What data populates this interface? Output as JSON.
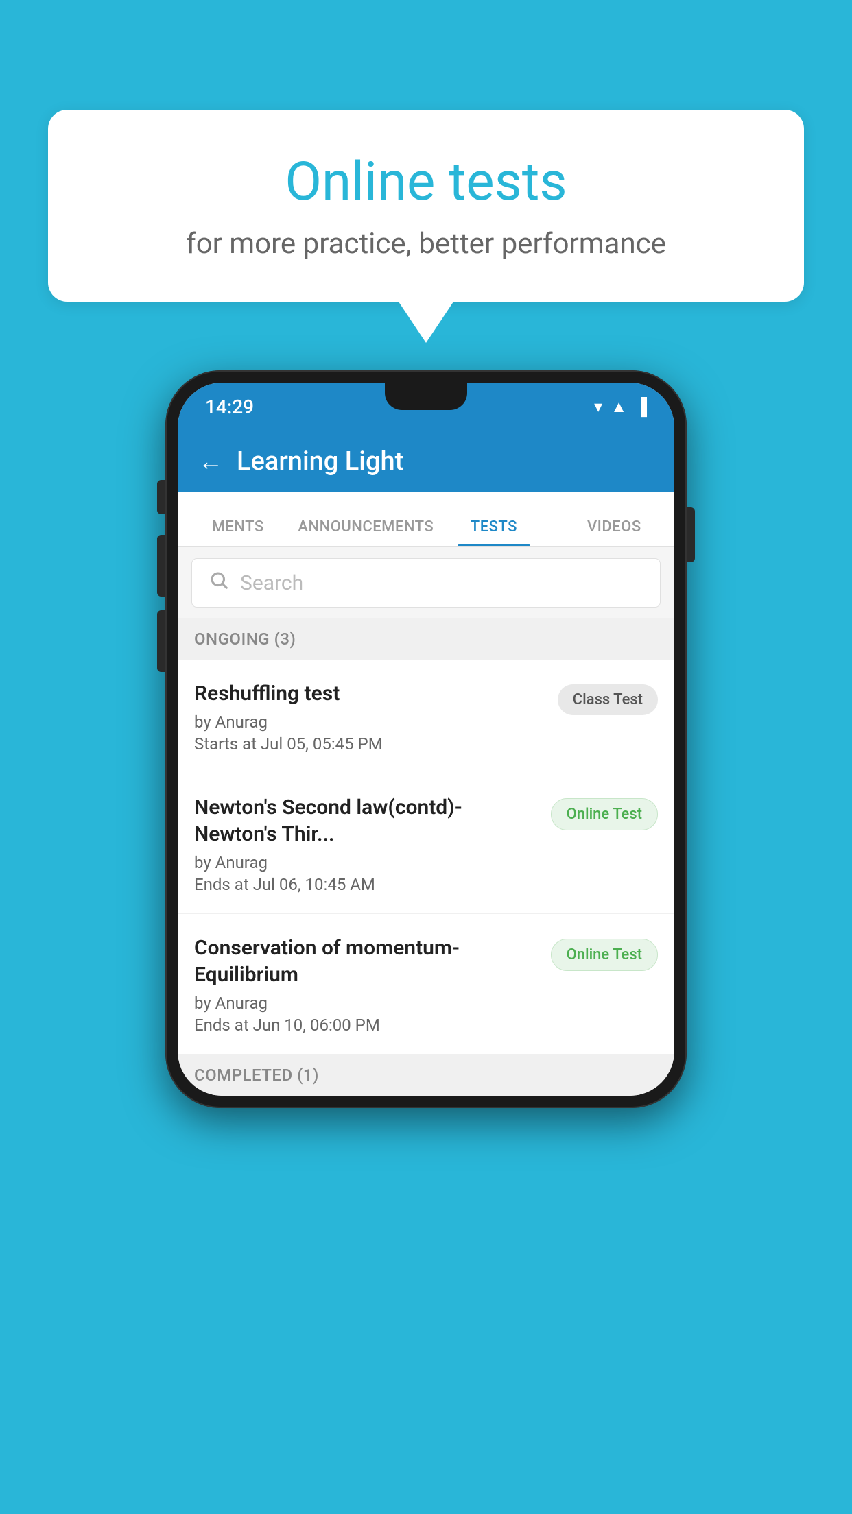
{
  "background": {
    "color": "#29b6d8"
  },
  "speech_bubble": {
    "title": "Online tests",
    "subtitle": "for more practice, better performance"
  },
  "phone": {
    "status_bar": {
      "time": "14:29",
      "wifi": "▼",
      "signal": "▲",
      "battery": "▐"
    },
    "app_header": {
      "back_label": "←",
      "title": "Learning Light"
    },
    "tabs": [
      {
        "label": "MENTS",
        "active": false
      },
      {
        "label": "ANNOUNCEMENTS",
        "active": false
      },
      {
        "label": "TESTS",
        "active": true
      },
      {
        "label": "VIDEOS",
        "active": false
      }
    ],
    "search": {
      "placeholder": "Search"
    },
    "ongoing_section": {
      "header": "ONGOING (3)",
      "items": [
        {
          "name": "Reshuffling test",
          "author": "by Anurag",
          "date": "Starts at  Jul 05, 05:45 PM",
          "badge": "Class Test",
          "badge_type": "class"
        },
        {
          "name": "Newton's Second law(contd)-Newton's Thir...",
          "author": "by Anurag",
          "date": "Ends at  Jul 06, 10:45 AM",
          "badge": "Online Test",
          "badge_type": "online"
        },
        {
          "name": "Conservation of momentum-Equilibrium",
          "author": "by Anurag",
          "date": "Ends at  Jun 10, 06:00 PM",
          "badge": "Online Test",
          "badge_type": "online"
        }
      ]
    },
    "completed_section": {
      "header": "COMPLETED (1)"
    }
  }
}
